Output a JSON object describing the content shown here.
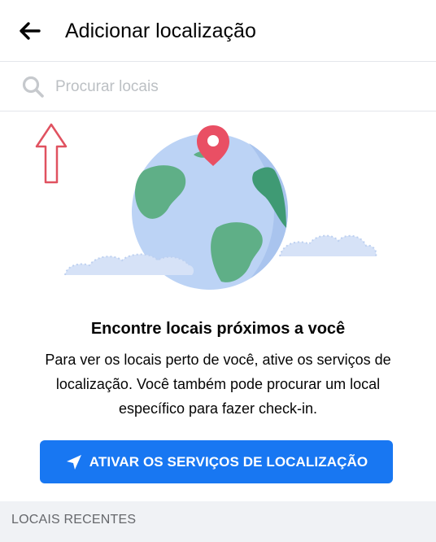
{
  "header": {
    "back_icon": "arrow-left-icon",
    "title": "Adicionar localização"
  },
  "search": {
    "icon": "search-icon",
    "placeholder": "Procurar locais"
  },
  "empty_state": {
    "illustration": "globe-with-pin-illustration",
    "title": "Encontre locais próximos a você",
    "description": "Para ver os locais perto de você, ative os serviços de localização. Você também pode procurar um local específico para fazer check-in."
  },
  "cta": {
    "icon": "location-arrow-icon",
    "label": "ATIVAR OS SERVIÇOS DE LOCALIZAÇÃO"
  },
  "recent": {
    "label": "LOCAIS RECENTES"
  },
  "colors": {
    "accent": "#1877f2",
    "pin": "#e94f64",
    "globe": "#bcd3f5",
    "land": "#5faf87",
    "annotation": "#e05260"
  }
}
